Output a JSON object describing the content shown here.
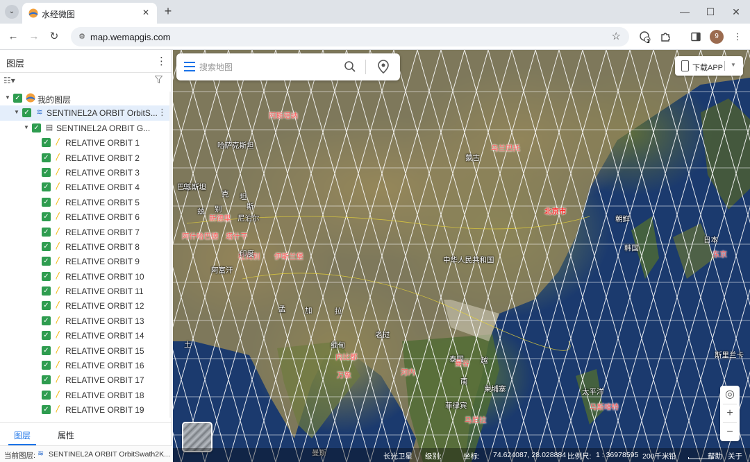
{
  "browser": {
    "tab_title": "水经微图",
    "url": "map.wemapgis.com",
    "profile_initial": "9",
    "extension_badge": "1"
  },
  "panel": {
    "title": "图层",
    "tree": {
      "root_label": "我的图层",
      "service_label": "SENTINEL2A ORBIT OrbitS...",
      "group_label": "SENTINEL2A ORBIT G...",
      "orbits": [
        "RELATIVE ORBIT 1",
        "RELATIVE ORBIT 2",
        "RELATIVE ORBIT 3",
        "RELATIVE ORBIT 4",
        "RELATIVE ORBIT 5",
        "RELATIVE ORBIT 6",
        "RELATIVE ORBIT 7",
        "RELATIVE ORBIT 8",
        "RELATIVE ORBIT 9",
        "RELATIVE ORBIT 10",
        "RELATIVE ORBIT 11",
        "RELATIVE ORBIT 12",
        "RELATIVE ORBIT 13",
        "RELATIVE ORBIT 14",
        "RELATIVE ORBIT 15",
        "RELATIVE ORBIT 16",
        "RELATIVE ORBIT 17",
        "RELATIVE ORBIT 18",
        "RELATIVE ORBIT 19"
      ]
    },
    "tabs": {
      "layers": "图层",
      "attributes": "属性"
    },
    "footer": {
      "label": "当前图层:",
      "value": "SENTINEL2A ORBIT OrbitSwath2K..."
    }
  },
  "map": {
    "search_placeholder": "搜索地图",
    "download_app": "下载APP",
    "labels": [
      {
        "text": "阿斯塔纳",
        "style": "red"
      },
      {
        "text": "哈萨克斯坦",
        "style": "white"
      },
      {
        "text": "乌兰巴托",
        "style": "red"
      },
      {
        "text": "蒙古",
        "style": "white"
      },
      {
        "text": "北京市",
        "style": "cap"
      },
      {
        "text": "朝鲜",
        "style": "white"
      },
      {
        "text": "韩国",
        "style": "white"
      },
      {
        "text": "日本",
        "style": "white"
      },
      {
        "text": "东京",
        "style": "red"
      },
      {
        "text": "中华人民共和国",
        "style": "white"
      },
      {
        "text": "阿什哈巴德",
        "style": "red"
      },
      {
        "text": "塔什干",
        "style": "red"
      },
      {
        "text": "杜尚别",
        "style": "red"
      },
      {
        "text": "伊斯兰堡",
        "style": "red"
      },
      {
        "text": "阿富汗",
        "style": "white"
      },
      {
        "text": "巴基斯坦",
        "style": "white"
      },
      {
        "text": "新德里",
        "style": "red"
      },
      {
        "text": "尼泊尔",
        "style": "white"
      },
      {
        "text": "印度",
        "style": "white"
      },
      {
        "text": "孟",
        "style": "white"
      },
      {
        "text": "加",
        "style": "white"
      },
      {
        "text": "拉",
        "style": "white"
      },
      {
        "text": "缅甸",
        "style": "white"
      },
      {
        "text": "内比都",
        "style": "red"
      },
      {
        "text": "老挝",
        "style": "white"
      },
      {
        "text": "河内",
        "style": "red"
      },
      {
        "text": "万象",
        "style": "red"
      },
      {
        "text": "泰国",
        "style": "white"
      },
      {
        "text": "越",
        "style": "white"
      },
      {
        "text": "南",
        "style": "white"
      },
      {
        "text": "曼谷",
        "style": "red"
      },
      {
        "text": "柬埔寨",
        "style": "white"
      },
      {
        "text": "菲律宾",
        "style": "white"
      },
      {
        "text": "马尼拉",
        "style": "red"
      },
      {
        "text": "太平洋",
        "style": "white"
      },
      {
        "text": "马斯喀特",
        "style": "red"
      },
      {
        "text": "斯里兰卡",
        "style": "white"
      },
      {
        "text": "土",
        "style": "white"
      },
      {
        "text": "曼斯",
        "style": "white"
      },
      {
        "text": "乌",
        "style": "white"
      },
      {
        "text": "兹",
        "style": "white"
      },
      {
        "text": "别",
        "style": "white"
      },
      {
        "text": "克",
        "style": "white"
      },
      {
        "text": "坦",
        "style": "white"
      },
      {
        "text": "斯",
        "style": "white"
      }
    ],
    "status": {
      "source": "长光卫星",
      "level_label": "级别:",
      "coord_label": "坐标:",
      "coord_value": "74.624087, 28.028884",
      "scale_label": "比例尺:",
      "scale_value": "1 : 36978595",
      "scale_bar": "200千米",
      "scale_bar_extra": "铅",
      "help": "帮助",
      "about": "关于"
    }
  }
}
